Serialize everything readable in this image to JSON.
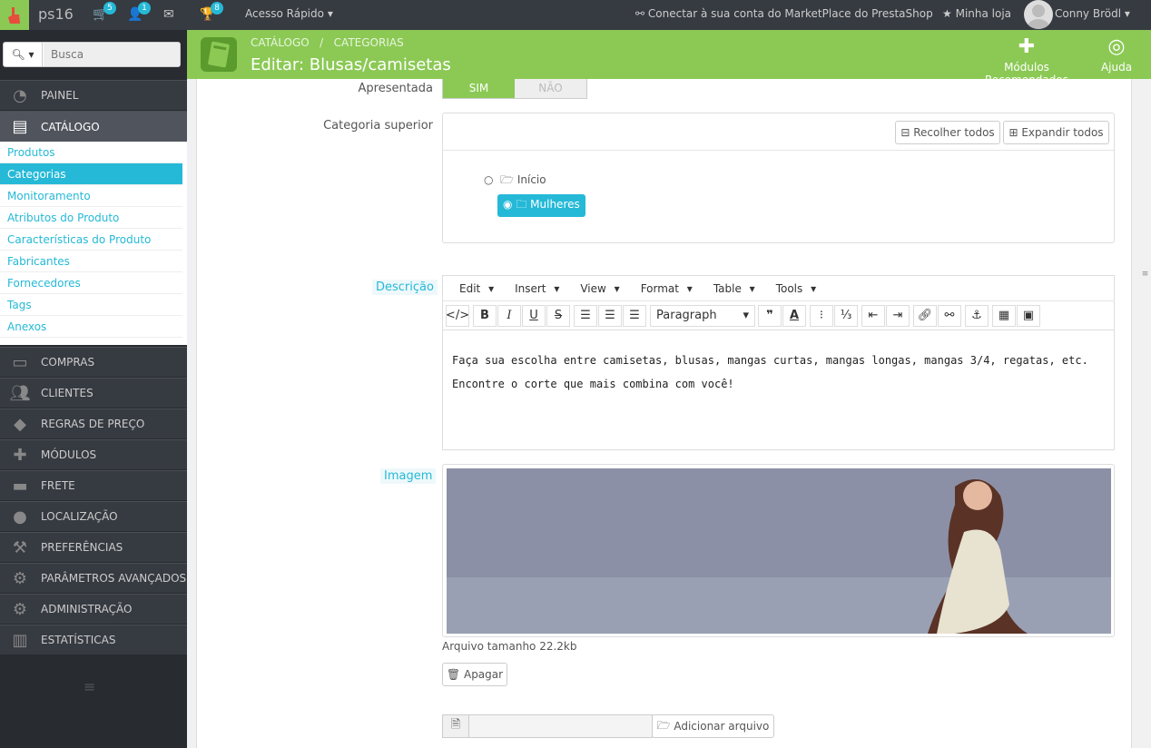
{
  "topbar": {
    "shop_name": "ps16",
    "cart_badge": "5",
    "customers_badge": "1",
    "trophy_badge": "8",
    "quick_access": "Acesso Rápido",
    "marketplace": "Conectar à sua conta do MarketPlace do PrestaShop",
    "my_store": "Minha loja",
    "user_name": "Conny Brödl"
  },
  "sidebar": {
    "search_placeholder": "Busca",
    "items": [
      {
        "label": "PAINEL",
        "icon": "dashboard-icon"
      },
      {
        "label": "CATÁLOGO",
        "icon": "book-icon"
      },
      {
        "label": "COMPRAS",
        "icon": "credit-card-icon"
      },
      {
        "label": "CLIENTES",
        "icon": "users-icon"
      },
      {
        "label": "REGRAS DE PREÇO",
        "icon": "tags-icon"
      },
      {
        "label": "MÓDULOS",
        "icon": "puzzle-icon"
      },
      {
        "label": "FRETE",
        "icon": "truck-icon"
      },
      {
        "label": "LOCALIZAÇÃO",
        "icon": "globe-icon"
      },
      {
        "label": "PREFERÊNCIAS",
        "icon": "wrench-icon"
      },
      {
        "label": "PARÂMETROS AVANÇADOS",
        "icon": "cogs-icon"
      },
      {
        "label": "ADMINISTRAÇÃO",
        "icon": "gear-icon"
      },
      {
        "label": "ESTATÍSTICAS",
        "icon": "bar-chart-icon"
      }
    ],
    "submenu": [
      "Produtos",
      "Categorias",
      "Monitoramento",
      "Atributos do Produto",
      "Características do Produto",
      "Fabricantes",
      "Fornecedores",
      "Tags",
      "Anexos"
    ]
  },
  "header": {
    "breadcrumb_1": "CATÁLOGO",
    "breadcrumb_sep": "/",
    "breadcrumb_2": "CATEGORIAS",
    "title": "Editar: Blusas/camisetas",
    "recommended": "Módulos Recomendados",
    "help": "Ajuda"
  },
  "form": {
    "displayed_label": "Apresentada",
    "yes": "SIM",
    "no": "NÃO",
    "parent_label": "Categoria superior",
    "collapse_all": "Recolher todos",
    "expand_all": "Expandir todos",
    "tree_root": "Início",
    "tree_child": "Mulheres",
    "description_label": "Descrição",
    "editor_menu": [
      "Edit",
      "Insert",
      "View",
      "Format",
      "Table",
      "Tools"
    ],
    "paragraph": "Paragraph",
    "desc_line1": "Faça sua escolha entre camisetas, blusas, mangas curtas, mangas longas, mangas 3/4, regatas, etc.",
    "desc_line2": "Encontre o corte que mais combina com você!",
    "image_label": "Imagem",
    "file_size": "Arquivo tamanho 22.2kb",
    "delete": "Apagar",
    "add_file": "Adicionar arquivo"
  },
  "colors": {
    "accent": "#8bc954",
    "link": "#25b9d7",
    "sidebar": "#363a41"
  }
}
